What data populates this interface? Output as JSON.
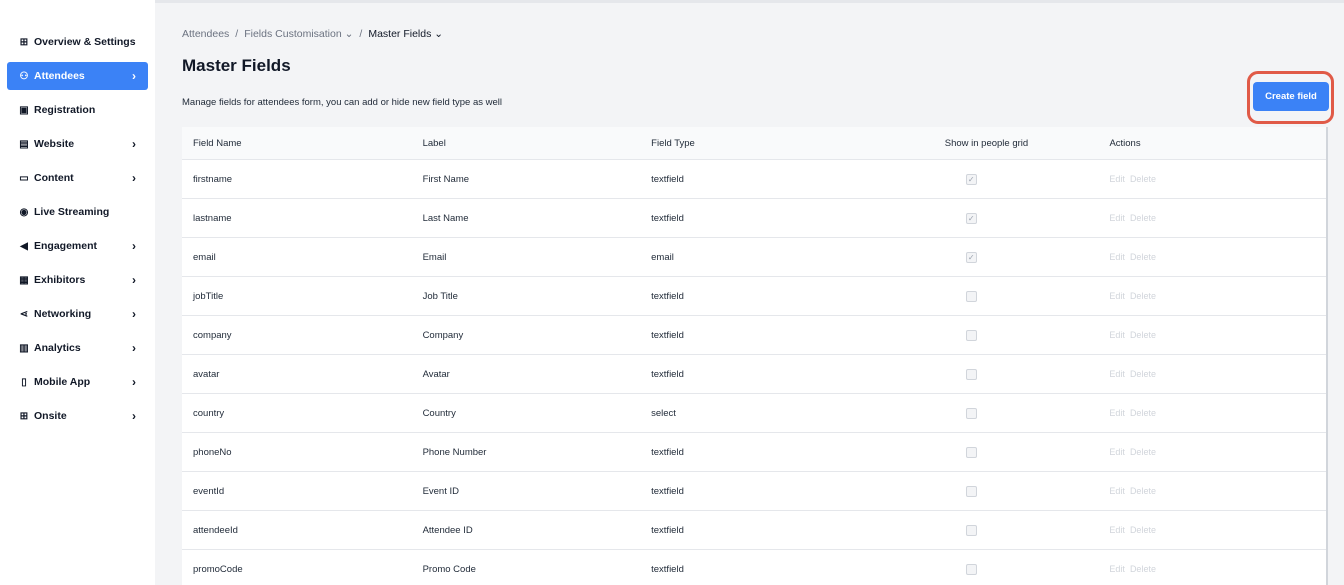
{
  "sidebar": {
    "items": [
      {
        "label": "Overview & Settings",
        "icon": "dashboard-icon",
        "glyph": "⊞",
        "chevron": false,
        "active": false
      },
      {
        "label": "Attendees",
        "icon": "people-icon",
        "glyph": "⚇",
        "chevron": true,
        "active": true
      },
      {
        "label": "Registration",
        "icon": "registration-icon",
        "glyph": "▣",
        "chevron": false,
        "active": false
      },
      {
        "label": "Website",
        "icon": "website-icon",
        "glyph": "▤",
        "chevron": true,
        "active": false
      },
      {
        "label": "Content",
        "icon": "folder-icon",
        "glyph": "▭",
        "chevron": true,
        "active": false
      },
      {
        "label": "Live Streaming",
        "icon": "broadcast-icon",
        "glyph": "◉",
        "chevron": false,
        "active": false
      },
      {
        "label": "Engagement",
        "icon": "megaphone-icon",
        "glyph": "◀",
        "chevron": true,
        "active": false
      },
      {
        "label": "Exhibitors",
        "icon": "store-icon",
        "glyph": "▦",
        "chevron": true,
        "active": false
      },
      {
        "label": "Networking",
        "icon": "share-icon",
        "glyph": "⋖",
        "chevron": true,
        "active": false
      },
      {
        "label": "Analytics",
        "icon": "bar-chart-icon",
        "glyph": "▥",
        "chevron": true,
        "active": false
      },
      {
        "label": "Mobile App",
        "icon": "mobile-icon",
        "glyph": "▯",
        "chevron": true,
        "active": false
      },
      {
        "label": "Onsite",
        "icon": "grid-icon",
        "glyph": "⊞",
        "chevron": true,
        "active": false
      }
    ],
    "chevron_glyph": "›"
  },
  "breadcrumb": {
    "items": [
      "Attendees",
      "Fields Customisation",
      "Master Fields"
    ],
    "separator": "/",
    "dropdown_glyph": "⌄"
  },
  "page": {
    "title": "Master Fields",
    "subtitle": "Manage fields for attendees form, you can add or hide new field type as well",
    "create_button": "Create field"
  },
  "table": {
    "headers": [
      "Field Name",
      "Label",
      "Field Type",
      "Show in people grid",
      "Actions"
    ],
    "action_edit": "Edit",
    "action_delete": "Delete",
    "check_glyph": "✓",
    "rows": [
      {
        "name": "firstname",
        "label": "First Name",
        "type": "textfield",
        "show": true
      },
      {
        "name": "lastname",
        "label": "Last Name",
        "type": "textfield",
        "show": true
      },
      {
        "name": "email",
        "label": "Email",
        "type": "email",
        "show": true
      },
      {
        "name": "jobTitle",
        "label": "Job Title",
        "type": "textfield",
        "show": false
      },
      {
        "name": "company",
        "label": "Company",
        "type": "textfield",
        "show": false
      },
      {
        "name": "avatar",
        "label": "Avatar",
        "type": "textfield",
        "show": false
      },
      {
        "name": "country",
        "label": "Country",
        "type": "select",
        "show": false
      },
      {
        "name": "phoneNo",
        "label": "Phone Number",
        "type": "textfield",
        "show": false
      },
      {
        "name": "eventId",
        "label": "Event ID",
        "type": "textfield",
        "show": false
      },
      {
        "name": "attendeeId",
        "label": "Attendee ID",
        "type": "textfield",
        "show": false
      },
      {
        "name": "promoCode",
        "label": "Promo Code",
        "type": "textfield",
        "show": false
      }
    ]
  },
  "colors": {
    "accent": "#3b82f6",
    "highlight_ring": "#e05a47"
  }
}
